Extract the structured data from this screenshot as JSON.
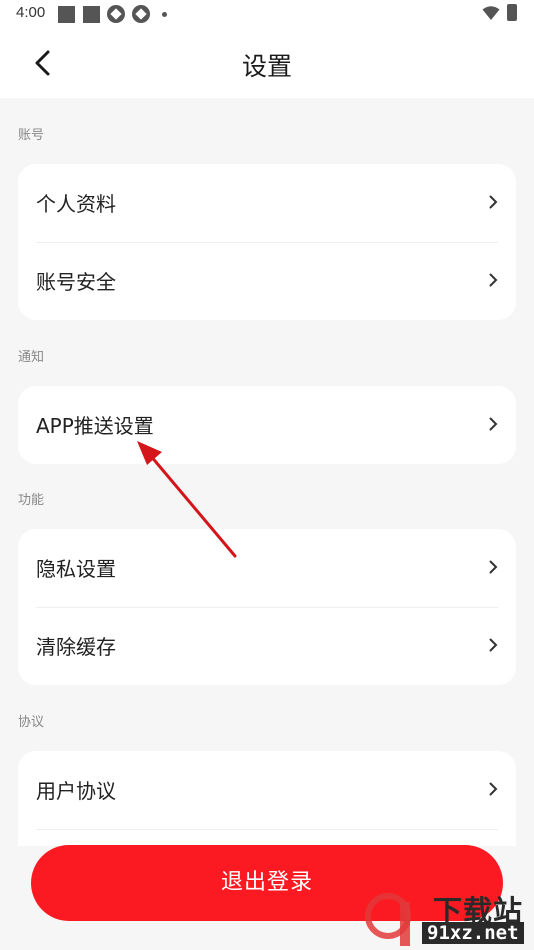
{
  "status_bar": {
    "time": "4:00"
  },
  "header": {
    "title": "设置"
  },
  "sections": [
    {
      "label": "账号",
      "items": [
        "个人资料",
        "账号安全"
      ]
    },
    {
      "label": "通知",
      "items": [
        "APP推送设置"
      ]
    },
    {
      "label": "功能",
      "items": [
        "隐私设置",
        "清除缓存"
      ]
    },
    {
      "label": "协议",
      "items": [
        "用户协议"
      ]
    }
  ],
  "logout": {
    "label": "退出登录"
  },
  "colors": {
    "accent": "#fc1a22",
    "background": "#f6f6f6",
    "card": "#ffffff"
  },
  "watermark": {
    "line1": "下载站",
    "line2": "91xz.net"
  }
}
